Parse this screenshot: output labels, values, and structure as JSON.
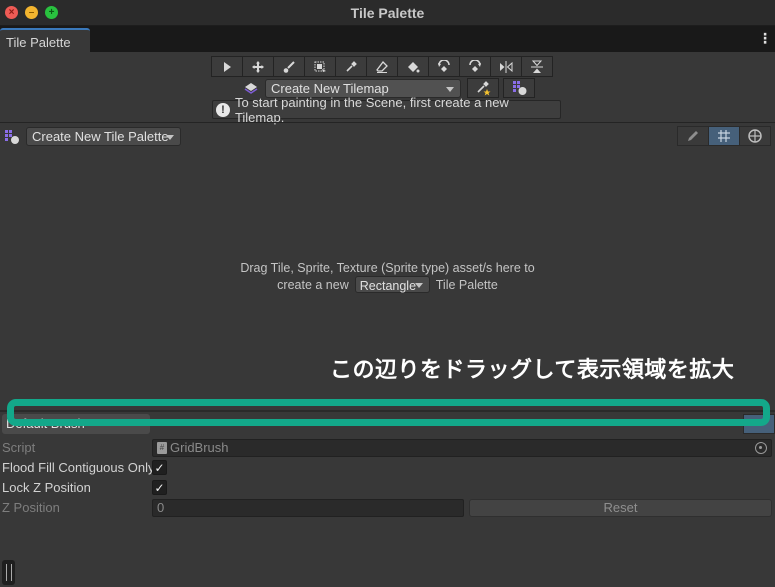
{
  "window": {
    "title": "Tile Palette",
    "traffic_lights": [
      "close",
      "minimize",
      "maximize"
    ]
  },
  "tabbar": {
    "active_tab": "Tile Palette",
    "menu_icon": "kebab-menu-icon"
  },
  "toolbar": {
    "tools": [
      {
        "name": "select",
        "icon": "arrow-cursor-icon"
      },
      {
        "name": "move",
        "icon": "move-arrows-icon"
      },
      {
        "name": "paint",
        "icon": "paintbrush-icon"
      },
      {
        "name": "box-fill",
        "icon": "box-fill-icon"
      },
      {
        "name": "pick",
        "icon": "eyedropper-icon"
      },
      {
        "name": "erase",
        "icon": "eraser-icon"
      },
      {
        "name": "flood-fill",
        "icon": "paint-bucket-icon"
      },
      {
        "name": "rotate-ccw",
        "icon": "rotate-left-icon"
      },
      {
        "name": "rotate-cw",
        "icon": "rotate-right-icon"
      },
      {
        "name": "flip-x",
        "icon": "flip-horizontal-icon"
      },
      {
        "name": "flip-y",
        "icon": "flip-vertical-icon"
      }
    ],
    "tilemap_dropdown": "Create New Tilemap",
    "help_text": "To start painting in the Scene, first create a new Tilemap."
  },
  "palette": {
    "dropdown": "Create New Tile Palette",
    "view_tools": [
      "edit-pencil-icon",
      "grid-icon",
      "gizmo-sphere-icon"
    ],
    "active_view_tool": "grid-icon"
  },
  "drop_area": {
    "line1": "Drag Tile, Sprite, Texture (Sprite type) asset/s here to",
    "line2_prefix": "create a new",
    "shape_dropdown": "Rectangle",
    "line2_suffix": "Tile Palette"
  },
  "annotation": {
    "text": "この辺りをドラッグして表示領域を拡大",
    "color": "#13a88a"
  },
  "brush": {
    "dropdown": "Default Brush",
    "properties": {
      "script_label": "Script",
      "script_value": "GridBrush",
      "flood_fill_label": "Flood Fill Contiguous Only",
      "flood_fill_checked": true,
      "lock_z_label": "Lock Z Position",
      "lock_z_checked": true,
      "z_position_label": "Z Position",
      "z_position_value": "0",
      "reset_label": "Reset"
    }
  }
}
